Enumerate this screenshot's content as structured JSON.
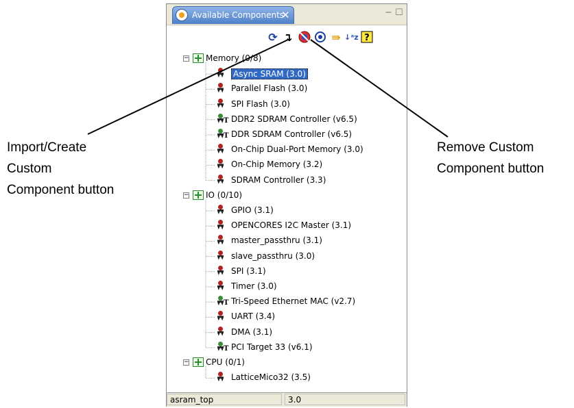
{
  "panel": {
    "title": "Available Components",
    "close_glyph": "✕",
    "minimize_glyph": "−",
    "maximize_glyph": "☐"
  },
  "toolbar": {
    "icons": [
      "refresh-icon",
      "import-create-icon",
      "remove-custom-icon",
      "target-icon",
      "filter-icon",
      "sort-az-icon",
      "help-icon"
    ]
  },
  "tree": {
    "categories": [
      {
        "label": "Memory (0/8)",
        "expander": "−",
        "items": [
          {
            "label": "Async SRAM (3.0)",
            "selected": true
          },
          {
            "label": "Parallel Flash (3.0)"
          },
          {
            "label": "SPI Flash (3.0)"
          },
          {
            "label": "DDR2 SDRAM Controller (v6.5)",
            "ip": true
          },
          {
            "label": "DDR SDRAM Controller (v6.5)",
            "ip": true
          },
          {
            "label": "On-Chip Dual-Port Memory (3.0)"
          },
          {
            "label": "On-Chip Memory (3.2)"
          },
          {
            "label": "SDRAM Controller (3.3)"
          }
        ]
      },
      {
        "label": "IO (0/10)",
        "expander": "−",
        "items": [
          {
            "label": "GPIO (3.1)"
          },
          {
            "label": "OPENCORES I2C Master (3.1)"
          },
          {
            "label": "master_passthru (3.1)"
          },
          {
            "label": "slave_passthru (3.0)"
          },
          {
            "label": "SPI (3.1)"
          },
          {
            "label": "Timer (3.0)"
          },
          {
            "label": "Tri-Speed Ethernet MAC (v2.7)",
            "ip": true
          },
          {
            "label": "UART (3.4)"
          },
          {
            "label": "DMA (3.1)"
          },
          {
            "label": "PCI Target 33 (v6.1)",
            "ip": true
          }
        ]
      },
      {
        "label": "CPU (0/1)",
        "expander": "−",
        "items": [
          {
            "label": "LatticeMico32 (3.5)"
          }
        ]
      }
    ]
  },
  "status": {
    "left": "asram_top",
    "right": "3.0"
  },
  "callouts": {
    "import_line1": "Import/Create",
    "import_line2": "Custom",
    "import_line3": "Component button",
    "remove_line1": "Remove Custom",
    "remove_line2": "Component button"
  }
}
